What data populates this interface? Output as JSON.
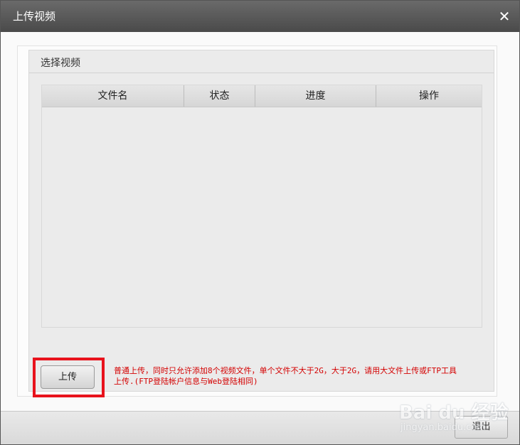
{
  "dialog": {
    "title": "上传视频",
    "close_glyph": "✕"
  },
  "group": {
    "label": "选择视频"
  },
  "table": {
    "columns": [
      "文件名",
      "状态",
      "进度",
      "操作"
    ],
    "rows": []
  },
  "upload": {
    "button_label": "上传",
    "notice_line1": "普通上传，同时只允许添加8个视频文件，单个文件不大于2G，大于2G，请用大文件上传或FTP工具",
    "notice_line2": "上传.(FTP登陆帐户信息与Web登陆相同)"
  },
  "footer": {
    "exit_label": "退出"
  },
  "watermark": {
    "text": "Bai du 经验",
    "sub": "jingyan.baidu.com"
  },
  "colors": {
    "titlebar": "#555555",
    "highlight_border": "#e8121c",
    "notice_text": "#d40000"
  }
}
